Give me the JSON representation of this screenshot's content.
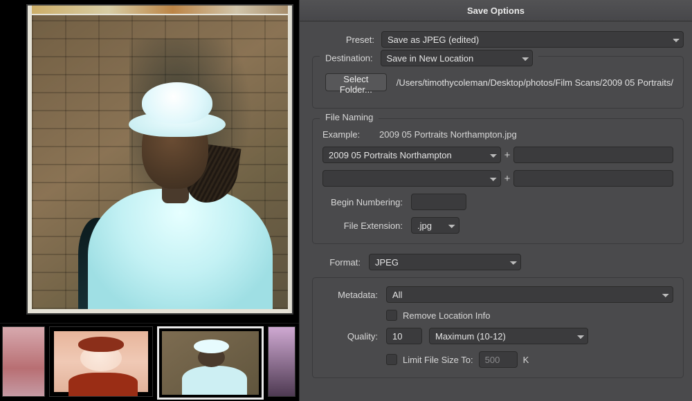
{
  "panel": {
    "title": "Save Options",
    "preset_label": "Preset:",
    "preset_value": "Save as JPEG (edited)"
  },
  "destination": {
    "group_label": "Destination:",
    "mode": "Save in New Location",
    "select_folder_btn": "Select Folder...",
    "path": "/Users/timothycoleman/Desktop/photos/Film Scans/2009 05 Portraits/"
  },
  "file_naming": {
    "group_label": "File Naming",
    "example_label": "Example:",
    "example_value": "2009 05 Portraits Northampton.jpg",
    "name_part1": "2009 05 Portraits Northampton",
    "name_part2": "",
    "begin_numbering_label": "Begin Numbering:",
    "begin_numbering_value": "",
    "file_ext_label": "File Extension:",
    "file_ext_value": ".jpg",
    "plus": "+"
  },
  "format": {
    "format_label": "Format:",
    "format_value": "JPEG",
    "metadata_label": "Metadata:",
    "metadata_value": "All",
    "remove_loc_label": "Remove Location Info",
    "quality_label": "Quality:",
    "quality_value": "10",
    "quality_preset": "Maximum  (10-12)",
    "limit_size_label": "Limit File Size To:",
    "limit_size_value": "500",
    "limit_size_unit": "K"
  },
  "thumbs": {
    "count": 4,
    "selected_index": 2
  }
}
